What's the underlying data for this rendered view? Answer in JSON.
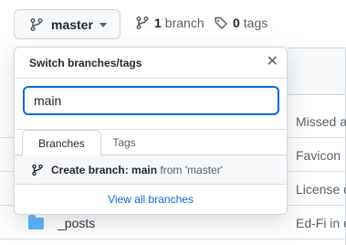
{
  "topbar": {
    "branch_label": "master",
    "branches_count": "1",
    "branches_label": "branch",
    "tags_count": "0",
    "tags_label": "tags"
  },
  "dropdown": {
    "title": "Switch branches/tags",
    "filter_value": "main",
    "tabs": [
      "Branches",
      "Tags"
    ],
    "create_prefix": "Create branch:",
    "create_name": "main",
    "create_from": "from 'master'",
    "view_all": "View all branches"
  },
  "files": {
    "posts_name": "_posts",
    "messages": [
      "Missed a",
      "Favicon",
      "License c",
      "Ed-Fi in c"
    ]
  }
}
